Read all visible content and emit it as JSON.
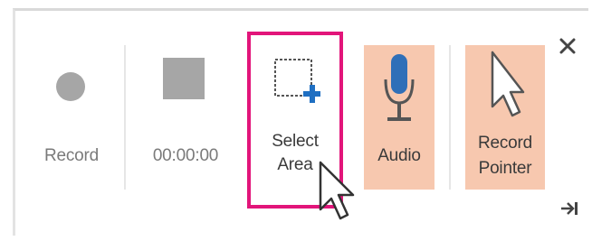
{
  "toolbar": {
    "buttons": [
      {
        "id": "record",
        "label": "Record",
        "icon": "record-circle-icon",
        "state": "disabled"
      },
      {
        "id": "stop",
        "label": "00:00:00",
        "icon": "stop-square-icon",
        "state": "disabled"
      },
      {
        "id": "select-area",
        "label_line1": "Select",
        "label_line2": "Area",
        "icon": "select-area-icon",
        "state": "highlighted"
      },
      {
        "id": "audio",
        "label": "Audio",
        "icon": "microphone-icon",
        "state": "active"
      },
      {
        "id": "record-pointer",
        "label_line1": "Record",
        "label_line2": "Pointer",
        "icon": "pointer-icon",
        "state": "active"
      }
    ],
    "close_icon": "close-icon",
    "pin_icon": "pin-icon"
  },
  "colors": {
    "active_bg": "#f7c8af",
    "highlight": "#e2157a",
    "disabled_icon": "#a6a6a6",
    "mic_blue": "#2f6fb8",
    "plus_blue": "#1f6fc2"
  }
}
